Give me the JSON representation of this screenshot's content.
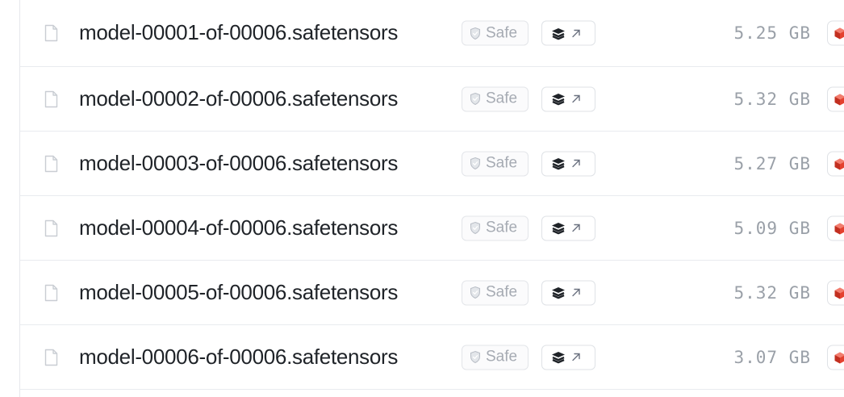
{
  "files": [
    {
      "name": "model-00001-of-00006.safetensors",
      "badge": "Safe",
      "size": "5.25 GB"
    },
    {
      "name": "model-00002-of-00006.safetensors",
      "badge": "Safe",
      "size": "5.32 GB"
    },
    {
      "name": "model-00003-of-00006.safetensors",
      "badge": "Safe",
      "size": "5.27 GB"
    },
    {
      "name": "model-00004-of-00006.safetensors",
      "badge": "Safe",
      "size": "5.09 GB"
    },
    {
      "name": "model-00005-of-00006.safetensors",
      "badge": "Safe",
      "size": "5.32 GB"
    },
    {
      "name": "model-00006-of-00006.safetensors",
      "badge": "Safe",
      "size": "3.07 GB"
    }
  ],
  "icons": {
    "file": "file-icon",
    "safe": "shield-icon",
    "viewer": "layers-icon",
    "external": "arrow-up-right-icon",
    "lfs": "lfs-cube-icon"
  },
  "colors": {
    "text": "#1f2328",
    "muted": "#9aa0a8",
    "border": "#e9ebef",
    "lfs_red": "#e4412f"
  }
}
